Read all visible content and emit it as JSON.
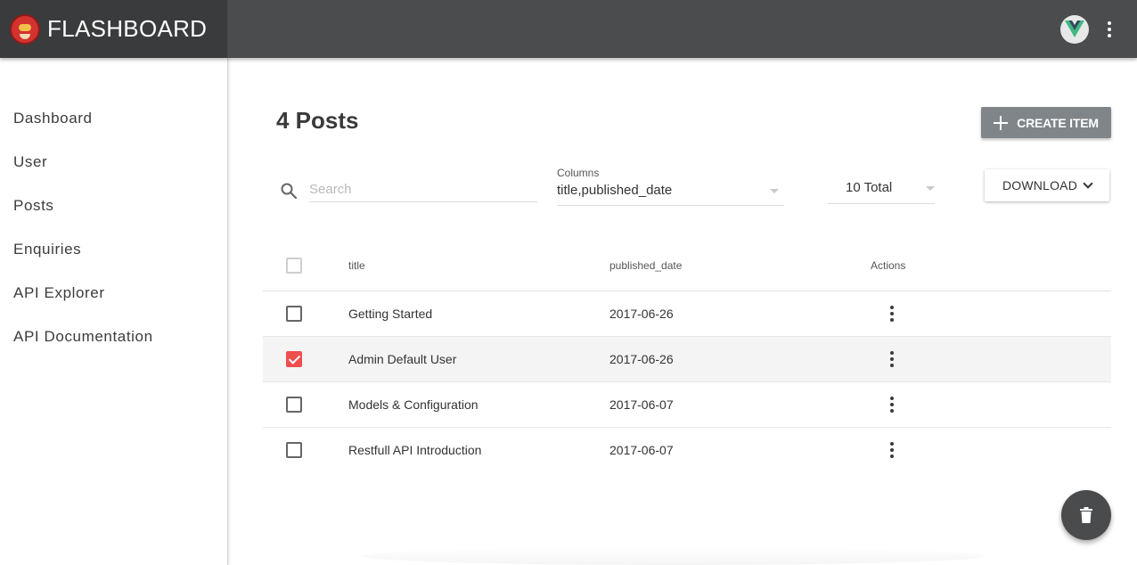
{
  "app": {
    "brand_name": "FLASHBOARD",
    "logo_icon": "flash-mascot-icon",
    "avatar_icon": "vue-logo-icon",
    "menu_icon": "more-vert-icon"
  },
  "sidebar": {
    "items": [
      {
        "label": "Dashboard"
      },
      {
        "label": "User"
      },
      {
        "label": "Posts"
      },
      {
        "label": "Enquiries"
      },
      {
        "label": "API Explorer"
      },
      {
        "label": "API Documentation"
      }
    ]
  },
  "main": {
    "title": "4 Posts",
    "create_label": "CREATE ITEM",
    "search": {
      "placeholder": "Search",
      "value": ""
    },
    "columns": {
      "label": "Columns",
      "value": "title,published_date"
    },
    "total": {
      "value": "10 Total"
    },
    "download_label": "DOWNLOAD"
  },
  "table": {
    "headers": {
      "title": "title",
      "published_date": "published_date",
      "actions": "Actions"
    },
    "rows": [
      {
        "title": "Getting Started",
        "published_date": "2017-06-26",
        "checked": false
      },
      {
        "title": "Admin Default User",
        "published_date": "2017-06-26",
        "checked": true
      },
      {
        "title": "Models & Configuration",
        "published_date": "2017-06-07",
        "checked": false
      },
      {
        "title": "Restfull API Introduction",
        "published_date": "2017-06-07",
        "checked": false
      }
    ]
  },
  "colors": {
    "topbar": "#4b4c4e",
    "brand_bg": "#3a3b3d",
    "accent_checked": "#ef4e4e",
    "create_button": "#808589",
    "fab": "#4a4b4d"
  },
  "fab": {
    "icon": "trash-icon"
  }
}
